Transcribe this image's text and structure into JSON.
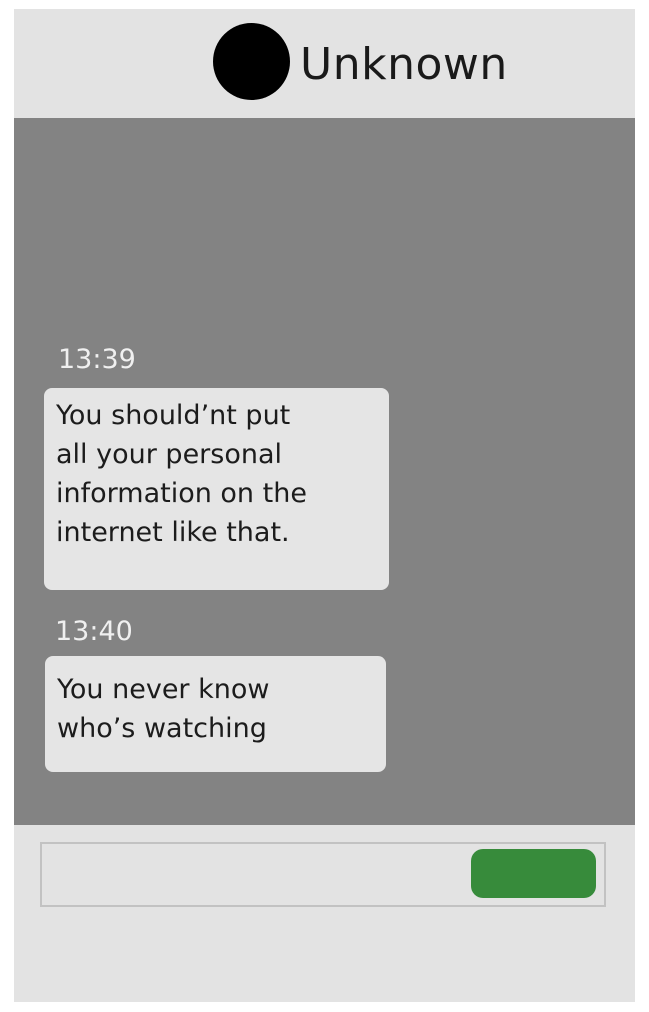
{
  "header": {
    "contact_name": "Unknown",
    "avatar_color": "#000000"
  },
  "messages": [
    {
      "time": "13:39",
      "text": "You should’nt put\nall your personal\ninformation on the\ninternet like that."
    },
    {
      "time": "13:40",
      "text": " You never know\nwho’s watching"
    }
  ],
  "compose": {
    "input_value": "",
    "send_button_color": "#378b3b"
  },
  "colors": {
    "chat_background": "#838383",
    "header_background": "#e3e3e3",
    "bubble_background": "#e5e5e5"
  }
}
